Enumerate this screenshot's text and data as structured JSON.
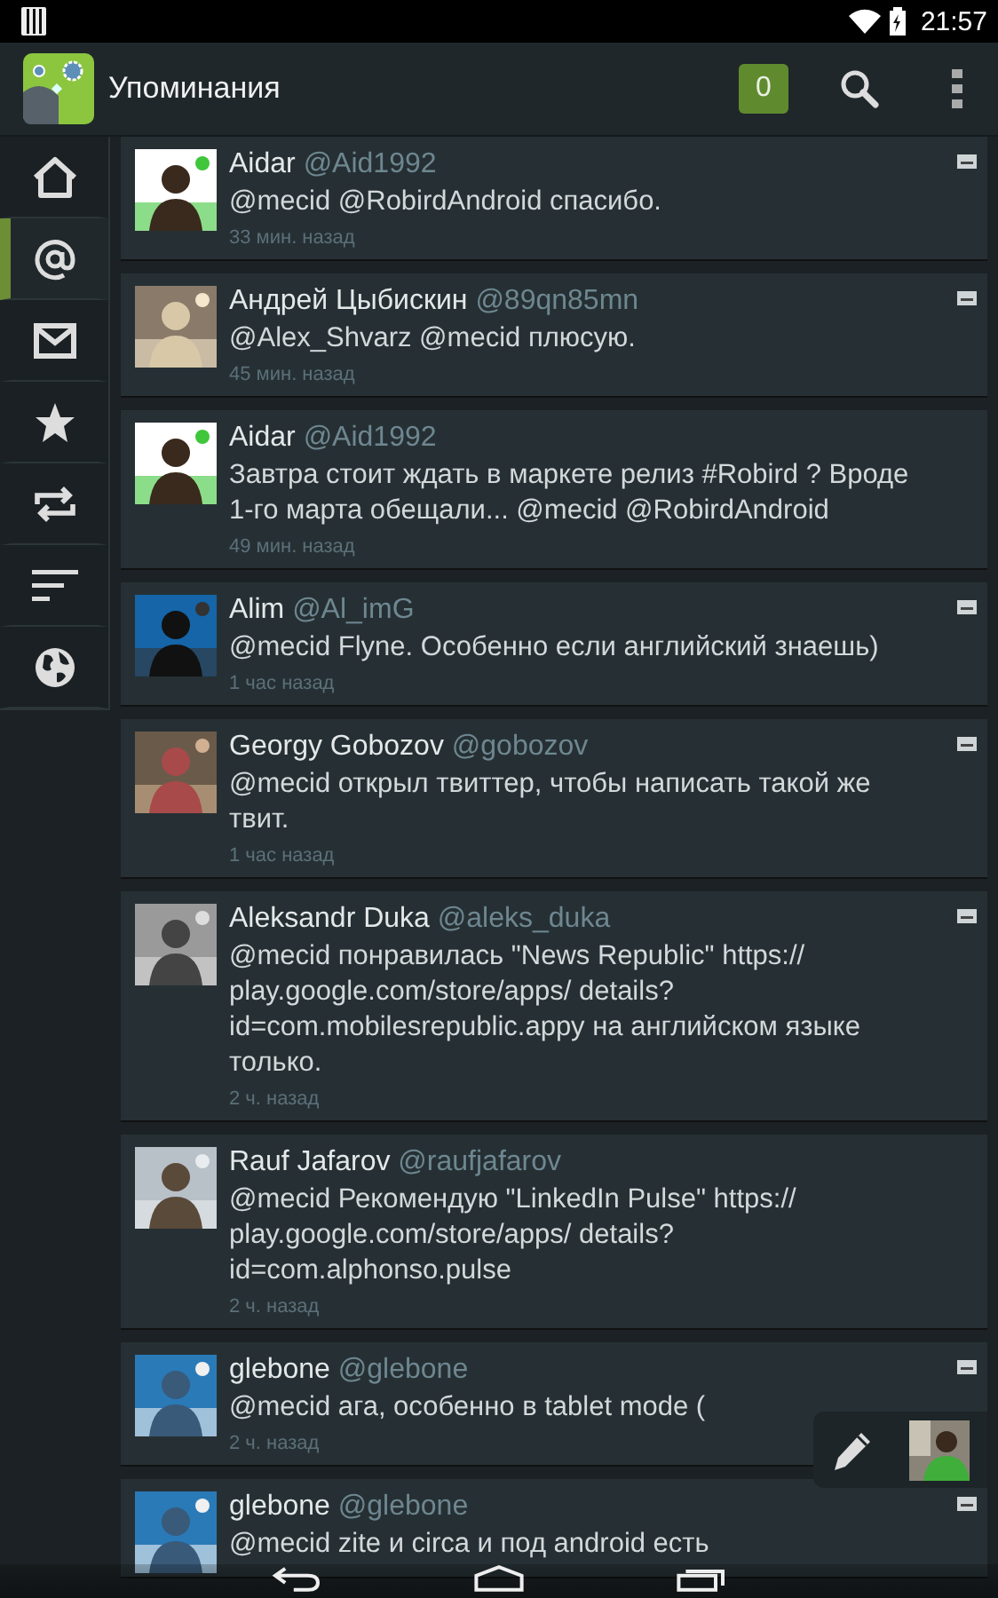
{
  "status_bar": {
    "time": "21:57"
  },
  "action_bar": {
    "title": "Упоминания",
    "badge": "0"
  },
  "sidebar": {
    "items": [
      {
        "kind": "home",
        "selected": false
      },
      {
        "kind": "mentions",
        "selected": true
      },
      {
        "kind": "messages",
        "selected": false
      },
      {
        "kind": "favorites",
        "selected": false
      },
      {
        "kind": "retweets",
        "selected": false
      },
      {
        "kind": "lists",
        "selected": false
      },
      {
        "kind": "world",
        "selected": false
      }
    ]
  },
  "tweets": [
    {
      "name": "Aidar",
      "handle": "@Aid1992",
      "text": "@mecid @RobirdAndroid спасибо.",
      "time": "33 мин. назад",
      "flag": true
    },
    {
      "name": "Андрей Цыбискин",
      "handle": "@89qn85mn",
      "text": "@Alex_Shvarz @mecid плюсую.",
      "time": "45 мин. назад",
      "flag": true
    },
    {
      "name": "Aidar",
      "handle": "@Aid1992",
      "text": "Завтра стоит ждать в маркете релиз #Robird ? Вроде 1-го марта обещали... @mecid @RobirdAndroid",
      "time": "49 мин. назад",
      "flag": false
    },
    {
      "name": "Alim",
      "handle": "@Al_imG",
      "text": "@mecid Flyne. Особенно если английский знаешь)",
      "time": "1 час назад",
      "flag": true
    },
    {
      "name": "Georgy Gobozov",
      "handle": "@gobozov",
      "text": "@mecid открыл твиттер, чтобы написать такой же твит.",
      "time": "1 час назад",
      "flag": true
    },
    {
      "name": "Aleksandr Duka",
      "handle": "@aleks_duka",
      "text": "@mecid понравилась \"News Republic\" https:// play.google.com/store/apps/ details?id=com.mobilesrepublic.appy на английском языке только.",
      "time": "2 ч. назад",
      "flag": true
    },
    {
      "name": "Rauf Jafarov",
      "handle": "@raufjafarov",
      "text": "@mecid Рекомендую \"LinkedIn Pulse\" https:// play.google.com/store/apps/ details?id=com.alphonso.pulse",
      "time": "2 ч. назад",
      "flag": false
    },
    {
      "name": "glebone",
      "handle": "@glebone",
      "text": "@mecid ага, особенно в tablet mode (",
      "time": "2 ч. назад",
      "flag": true
    },
    {
      "name": "glebone",
      "handle": "@glebone",
      "text": "@mecid zite и circa и под android есть",
      "flag": true
    }
  ]
}
